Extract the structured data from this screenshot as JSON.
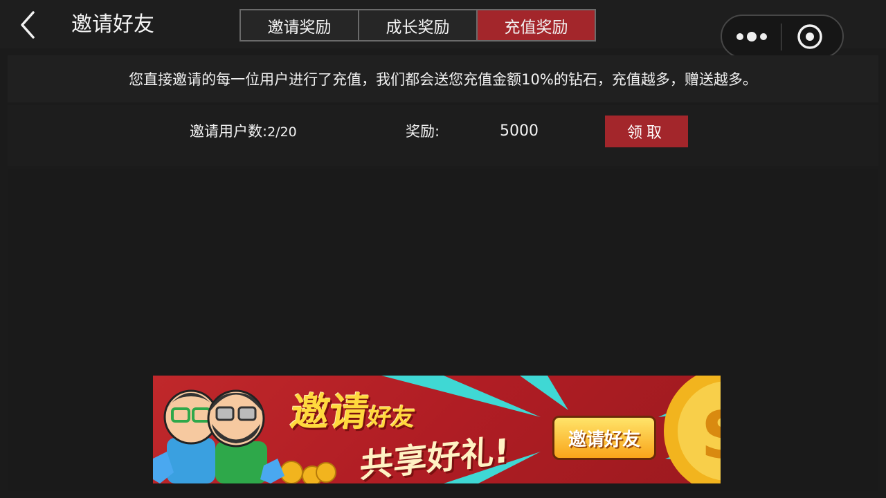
{
  "header": {
    "title": "邀请好友",
    "tabs": [
      {
        "label": "邀请奖励",
        "active": false
      },
      {
        "label": "成长奖励",
        "active": false
      },
      {
        "label": "充值奖励",
        "active": true
      }
    ]
  },
  "notice": {
    "text": "您直接邀请的每一位用户进行了充值，我们都会送您充值金额10%的钻石，充值越多，赠送越多。"
  },
  "reward": {
    "invite_label": "邀请用户数:",
    "invite_count": "2/20",
    "reward_label": "奖励:",
    "reward_value": "5000",
    "claim_label": "领取"
  },
  "banner": {
    "title_main": "邀请",
    "title_small": "好友",
    "subtitle": "共享好礼!",
    "button_label": "邀请好友"
  },
  "colors": {
    "accent": "#a3262b",
    "background": "#1b1b1b",
    "banner_red": "#c0282b",
    "banner_gold": "#ffd93d"
  },
  "icons": {
    "back": "back-arrow-icon",
    "more": "more-dots-icon",
    "close": "target-close-icon"
  }
}
